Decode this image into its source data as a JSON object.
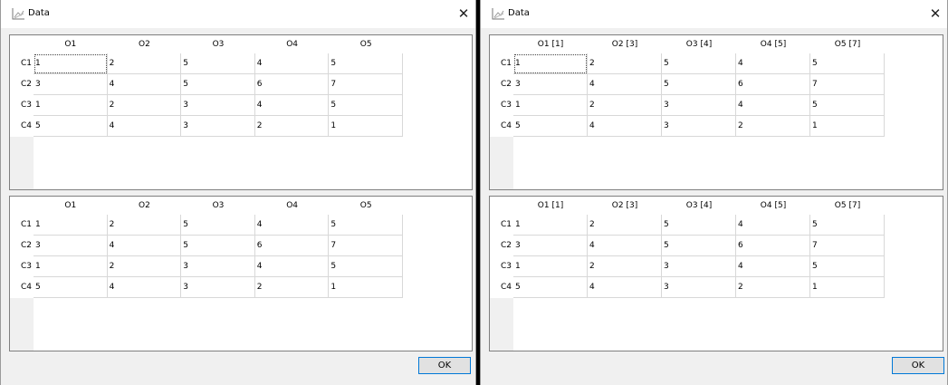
{
  "windows": [
    {
      "title": "Data",
      "close_glyph": "✕",
      "icon": "chart-icon",
      "ok_label": "OK",
      "column_headers": [
        "O1",
        "O2",
        "O3",
        "O4",
        "O5"
      ],
      "row_headers": [
        "C1",
        "C2",
        "C3",
        "C4"
      ],
      "tables": [
        [
          [
            "1",
            "2",
            "5",
            "4",
            "5"
          ],
          [
            "3",
            "4",
            "5",
            "6",
            "7"
          ],
          [
            "1",
            "2",
            "3",
            "4",
            "5"
          ],
          [
            "5",
            "4",
            "3",
            "2",
            "1"
          ]
        ],
        [
          [
            "1",
            "2",
            "5",
            "4",
            "5"
          ],
          [
            "3",
            "4",
            "5",
            "6",
            "7"
          ],
          [
            "1",
            "2",
            "3",
            "4",
            "5"
          ],
          [
            "5",
            "4",
            "3",
            "2",
            "1"
          ]
        ]
      ]
    },
    {
      "title": "Data",
      "close_glyph": "✕",
      "icon": "chart-icon",
      "ok_label": "OK",
      "column_headers": [
        "O1 [1]",
        "O2 [3]",
        "O3 [4]",
        "O4 [5]",
        "O5 [7]"
      ],
      "row_headers": [
        "C1",
        "C2",
        "C3",
        "C4"
      ],
      "tables": [
        [
          [
            "1",
            "2",
            "5",
            "4",
            "5"
          ],
          [
            "3",
            "4",
            "5",
            "6",
            "7"
          ],
          [
            "1",
            "2",
            "3",
            "4",
            "5"
          ],
          [
            "5",
            "4",
            "3",
            "2",
            "1"
          ]
        ],
        [
          [
            "1",
            "2",
            "5",
            "4",
            "5"
          ],
          [
            "3",
            "4",
            "5",
            "6",
            "7"
          ],
          [
            "1",
            "2",
            "3",
            "4",
            "5"
          ],
          [
            "5",
            "4",
            "3",
            "2",
            "1"
          ]
        ]
      ]
    }
  ]
}
